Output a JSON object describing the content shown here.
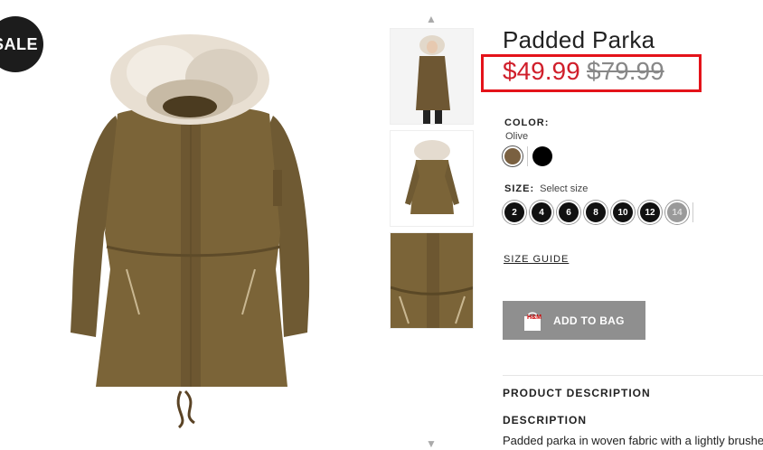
{
  "badge": {
    "label": "SALE"
  },
  "product": {
    "title": "Padded Parka",
    "price_sale": "$49.99",
    "price_original": "$79.99"
  },
  "color": {
    "label": "COLOR:",
    "selected": "Olive",
    "swatches": [
      "#7a6040",
      "#000000"
    ]
  },
  "size": {
    "label": "SIZE:",
    "hint": "Select size",
    "options": [
      "2",
      "4",
      "6",
      "8",
      "10",
      "12",
      "14"
    ],
    "unavailable": [
      "14"
    ]
  },
  "links": {
    "size_guide": "SIZE GUIDE"
  },
  "actions": {
    "add_to_bag": "ADD TO BAG",
    "bag_logo": "H&M"
  },
  "sections": {
    "product_description": "PRODUCT DESCRIPTION",
    "description": "DESCRIPTION",
    "description_text": "Padded parka in woven fabric with a lightly brushe"
  },
  "colors": {
    "price_red": "#d01f2b",
    "highlight_red": "#e4131a",
    "button_gray": "#8f8f8f"
  }
}
